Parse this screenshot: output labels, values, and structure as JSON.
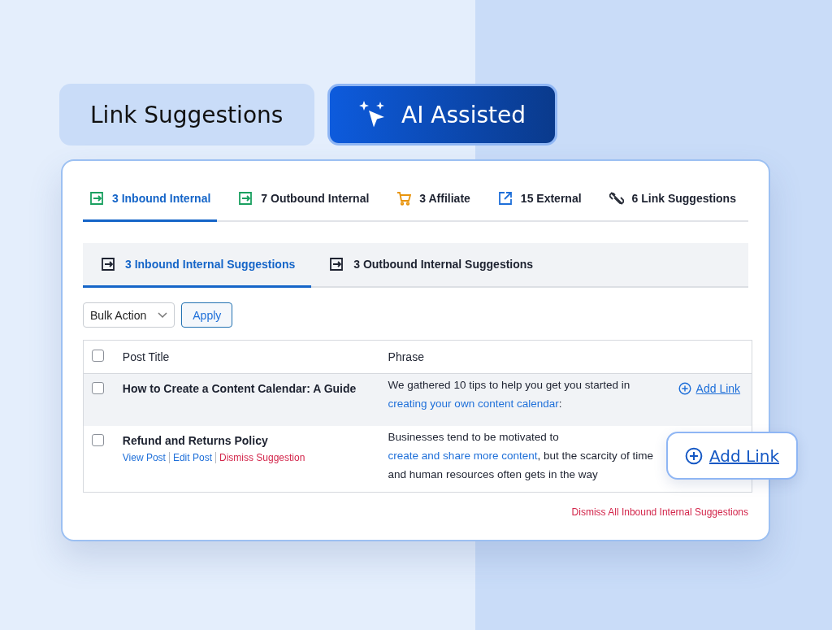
{
  "header": {
    "title": "Link Suggestions",
    "badge": "AI Assisted"
  },
  "tabs": [
    {
      "label": "3 Inbound Internal",
      "kind": "inbound",
      "selected": true
    },
    {
      "label": "7 Outbound Internal",
      "kind": "outbound",
      "selected": false
    },
    {
      "label": "3 Affiliate",
      "kind": "affiliate",
      "selected": false
    },
    {
      "label": "15 External",
      "kind": "external",
      "selected": false
    },
    {
      "label": "6 Link Suggestions",
      "kind": "suggestions",
      "selected": false
    }
  ],
  "subtabs": [
    {
      "label": "3 Inbound Internal Suggestions",
      "selected": true
    },
    {
      "label": "3 Outbound Internal Suggestions",
      "selected": false
    }
  ],
  "bulk_action": {
    "value": "Bulk Action",
    "apply": "Apply"
  },
  "table": {
    "columns": [
      "Post Title",
      "Phrase"
    ],
    "header_checked": false,
    "rows": [
      {
        "title": "How to Create a Content Calendar: A Guide",
        "checked": false,
        "highlighted": true,
        "actions": [],
        "phrase": [
          {
            "text": "We gathered 10 tips to help you get you started in ",
            "link": false
          },
          {
            "text": "creating your own content calendar",
            "link": true
          },
          {
            "text": ":",
            "link": false
          }
        ],
        "add_link": "Add Link"
      },
      {
        "title": "Refund and Returns Policy",
        "checked": false,
        "highlighted": false,
        "actions": [
          {
            "label": "View Post",
            "kind": "normal"
          },
          {
            "label": "Edit Post",
            "kind": "normal"
          },
          {
            "label": "Dismiss Suggestion",
            "kind": "danger"
          }
        ],
        "phrase": [
          {
            "text": " Businesses tend to be motivated to ",
            "link": false
          },
          {
            "text": "create and share more content",
            "link": true
          },
          {
            "text": ", but the scarcity of time and human resources often gets in the way",
            "link": false
          }
        ]
      }
    ]
  },
  "dismiss_all": "Dismiss All Inbound Internal Suggestions",
  "floating_button": "Add Link"
}
